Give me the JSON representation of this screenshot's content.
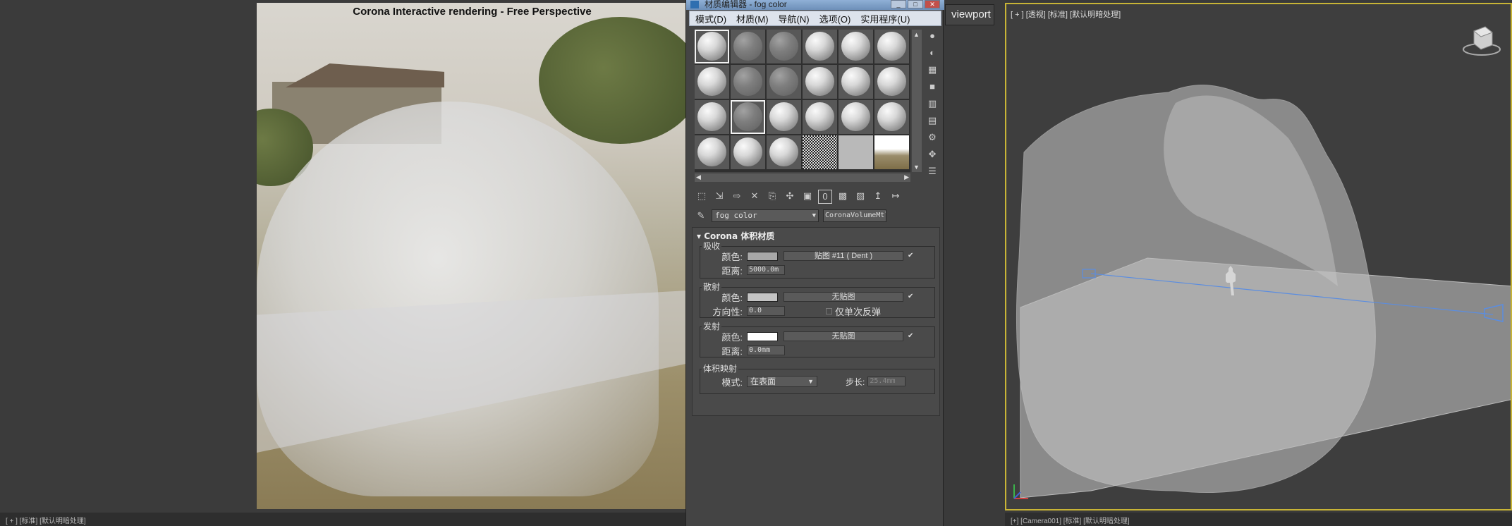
{
  "left_viewport": {
    "render_title": "Corona Interactive rendering - Free Perspective",
    "status_text": "[ + ] [标准] [默认明暗处理]"
  },
  "material_editor": {
    "title": "材质编辑器 - fog color",
    "window_buttons": [
      "_",
      "□",
      "✕"
    ],
    "menu": [
      "模式(D)",
      "材质(M)",
      "导航(N)",
      "选项(O)",
      "实用程序(U)"
    ],
    "slots": [
      {
        "kind": "ball",
        "selected": true
      },
      {
        "kind": "dim"
      },
      {
        "kind": "dim"
      },
      {
        "kind": "ball"
      },
      {
        "kind": "ball"
      },
      {
        "kind": "ball"
      },
      {
        "kind": "ball"
      },
      {
        "kind": "dim"
      },
      {
        "kind": "dim"
      },
      {
        "kind": "ball"
      },
      {
        "kind": "ball"
      },
      {
        "kind": "ball"
      },
      {
        "kind": "ball"
      },
      {
        "kind": "dim",
        "selected": true
      },
      {
        "kind": "ball"
      },
      {
        "kind": "ball"
      },
      {
        "kind": "ball"
      },
      {
        "kind": "ball"
      },
      {
        "kind": "ball"
      },
      {
        "kind": "ball"
      },
      {
        "kind": "ball"
      },
      {
        "kind": "noise"
      },
      {
        "kind": "plain"
      },
      {
        "kind": "field"
      }
    ],
    "side_tools": [
      "sphere-icon",
      "backlight-icon",
      "checker-icon",
      "box-icon",
      "color-bars-icon",
      "video-check-icon",
      "options-icon",
      "select-by-material-icon",
      "navigator-icon"
    ],
    "bottom_tools": [
      "get-material-icon",
      "put-material-icon",
      "assign-icon",
      "reset-icon",
      "make-copy-icon",
      "unique-icon",
      "put-library-icon",
      "material-id-icon",
      "show-map-icon",
      "show-end-icon",
      "go-parent-icon",
      "go-forward-icon"
    ],
    "material_id_text": "0",
    "material_name": "fog color",
    "material_type": "CoronaVolumeMtl",
    "rollout_title": "Corona 体积材质",
    "absorption": {
      "label": "吸收",
      "color_label": "颜色:",
      "color": "#a8a8a8",
      "map": "贴图 #11  ( Dent )",
      "distance_label": "距离:",
      "distance": "5000.0m"
    },
    "scattering": {
      "label": "散射",
      "color_label": "颜色:",
      "color": "#c4c4c4",
      "map": "无贴图",
      "direction_label": "方向性:",
      "direction": "0.0",
      "single_bounce_label": "仅单次反弹"
    },
    "emission": {
      "label": "发射",
      "color_label": "颜色:",
      "color": "#ffffff",
      "map": "无贴图",
      "distance_label": "距离:",
      "distance": "0.0mm"
    },
    "volume_mapping": {
      "label": "体积映射",
      "mode_label": "模式:",
      "mode": "在表面",
      "step_label": "步长:",
      "step": "25.4mm"
    }
  },
  "viewport_tab": "viewport",
  "right_viewport": {
    "label": "[ + ] [透视] [标准] [默认明暗处理]",
    "status_text": "[+] [Camera001] [标准] [默认明暗处理]"
  },
  "colors": {
    "viewport_border": "#c8b436",
    "titlebar": "#7a9cc4"
  }
}
